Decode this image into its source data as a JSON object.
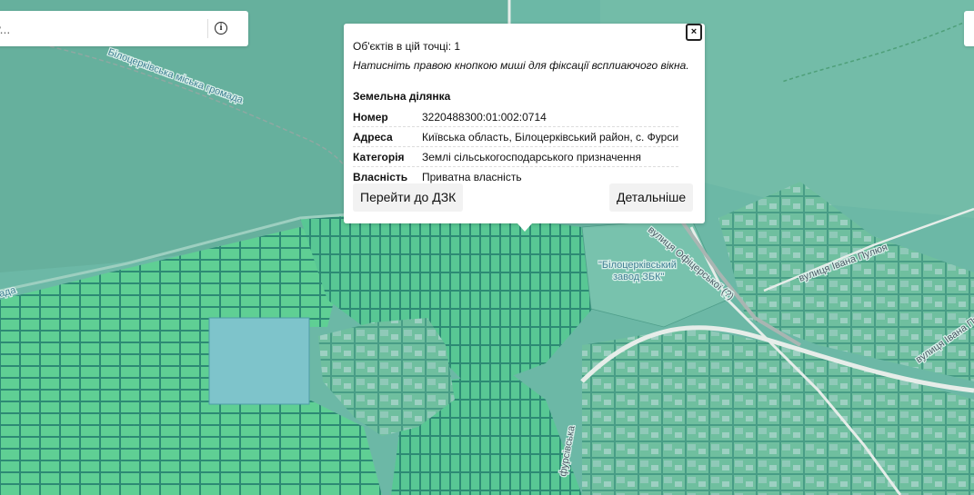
{
  "search": {
    "placeholder": "у...",
    "info_icon": "info-circle-icon",
    "info_glyph": "i"
  },
  "map": {
    "labels": {
      "community": "Білоцерківська міська громада",
      "plant": "\"Білоцерківський",
      "plant_line2": "завод ЗБК\"",
      "street_1": "вулиця Офіцерської (?)",
      "street_2": "вулиця Івана Пулюя",
      "street_3": "вулиця Івана Пулюя",
      "partial_left": "ада",
      "partial_bottom": "фурсівська"
    },
    "colors": {
      "base": "#6cb8a6",
      "forest": "#64b09c",
      "parcel_fill": "#5fcf94",
      "parcel_stroke": "#2d8a74",
      "pond": "#7ec4cb",
      "road": "#e6ede9",
      "rail": "#a9b5b2"
    }
  },
  "popup": {
    "count": "Об'єктів в цій точці: 1",
    "hint": "Натисніть правою кнопкою миші для фіксації всплиаючого вікна.",
    "heading": "Земельна ділянка",
    "rows": [
      {
        "key": "Номер",
        "value": "3220488300:01:002:0714"
      },
      {
        "key": "Адреса",
        "value": "Київська область, Білоцерківський район, с. Фурси"
      },
      {
        "key": "Категорія",
        "value": "Землі сільськогосподарського призначення"
      },
      {
        "key": "Власність",
        "value": "Приватна власність"
      }
    ],
    "buttons": {
      "dzk": "Перейти до ДЗК",
      "details": "Детальніше"
    },
    "close": "×"
  }
}
